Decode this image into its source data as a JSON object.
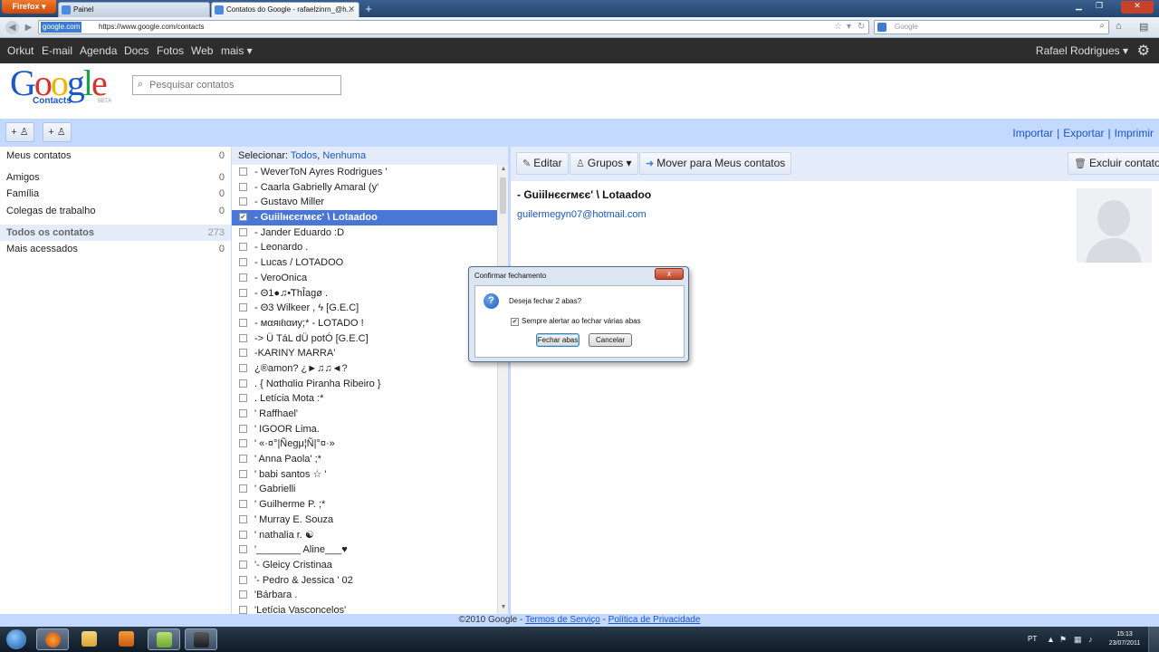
{
  "browser": {
    "menu_button": "Firefox ▾",
    "tabs": [
      {
        "label": "Painel"
      },
      {
        "label": "Contatos do Google - rafaelzinrn_@h..."
      }
    ],
    "new_tab": "+",
    "url_identity": "google.com",
    "url": "https://www.google.com/contacts",
    "search_placeholder": "Google"
  },
  "gbar": {
    "links": [
      "Orkut",
      "E-mail",
      "Agenda",
      "Docs",
      "Fotos",
      "Web",
      "mais ▾"
    ],
    "user": "Rafael Rodrigues ▾"
  },
  "header": {
    "logo_text": "Google",
    "logo_sub": "Contacts",
    "logo_beta": "BETA",
    "search_placeholder": "Pesquisar contatos"
  },
  "toolbar": {
    "add_contact": "+ ♙",
    "add_group": "+ ♙",
    "import": "Importar",
    "export": "Exportar",
    "print": "Imprimir",
    "sep": "|"
  },
  "sidebar": {
    "items": [
      {
        "label": "Meus contatos",
        "count": "0"
      },
      {
        "label": "Amigos",
        "count": "0"
      },
      {
        "label": "Família",
        "count": "0"
      },
      {
        "label": "Colegas de trabalho",
        "count": "0"
      },
      {
        "label": "Todos os contatos",
        "count": "273"
      },
      {
        "label": "Mais acessados",
        "count": "0"
      }
    ]
  },
  "list": {
    "select_label": "Selecionar:",
    "select_all": "Todos",
    "select_none": "Nenhuma",
    "contacts": [
      "- WeverToN Ayres Rodrigues '",
      "- Caarla Gabrielly Amaral (y'",
      "- Gustavo Miller",
      "- Guiilнєєrмєє' \\ Lotaadoo",
      "- Jander Eduardo :D",
      "- Leonardo .",
      "- Lucas / LOTADOO",
      "- VeroOnica",
      "- Θ1●♫•̃ThÎagø .",
      "- Θ3 Wilkeer , ϟ [G.E.C]",
      "- мαяιℓιαиу;* - LOTADO !",
      "-> Ü TáL dÜ potÓ [G.E.C]",
      "-KARINY MARRA'",
      "¿®amon? ¿►♫♫◄?",
      ". { Nαthαliα Piranha Ribeiro }",
      ".              Letícia Mota :*",
      "' Raffhael'",
      "' IGOOR Lima.",
      "' «·¤°|Ñegμ¦Ñ|°¤·»",
      "' Anna Paola' ;*",
      "' babi santos ☆ '",
      "' Gabrielli",
      "' Guilherme P. ;*",
      "' Murray E. Souza",
      "' nathalia r. ☯",
      "'________ Aline___♥",
      "'- Gleicy Cristinaa",
      "'- Pedro & Jessica ' 02",
      "'Bárbara .",
      "'Letícia Vasconcelos'"
    ],
    "selected_index": 3
  },
  "detail": {
    "edit": "Editar",
    "groups": "Grupos ▾",
    "move": "Mover para Meus contatos",
    "delete": "Excluir contato",
    "name": "- Guiilнєєrмєє' \\ Lotaadoo",
    "email": "guilermegyn07@hotmail.com"
  },
  "footer": {
    "copyright": "©2010 Google -",
    "terms": "Termos de Serviço",
    "dash": "-",
    "privacy": "Política de Privacidade"
  },
  "dialog": {
    "title": "Confirmar fechamento",
    "close": "x",
    "message": "Deseja fechar 2 abas?",
    "checkbox_label": "Sempre alertar ao fechar várias abas",
    "checkbox_checked": true,
    "ok": "Fechar abas",
    "cancel": "Cancelar"
  },
  "taskbar": {
    "lang": "PT",
    "time": "15:13",
    "date": "23/07/2011"
  },
  "colors": {
    "accent_blue": "#c3d9ff",
    "link": "#1a56cc",
    "selection": "#4a77d6",
    "gbar": "#2d2d2d"
  }
}
